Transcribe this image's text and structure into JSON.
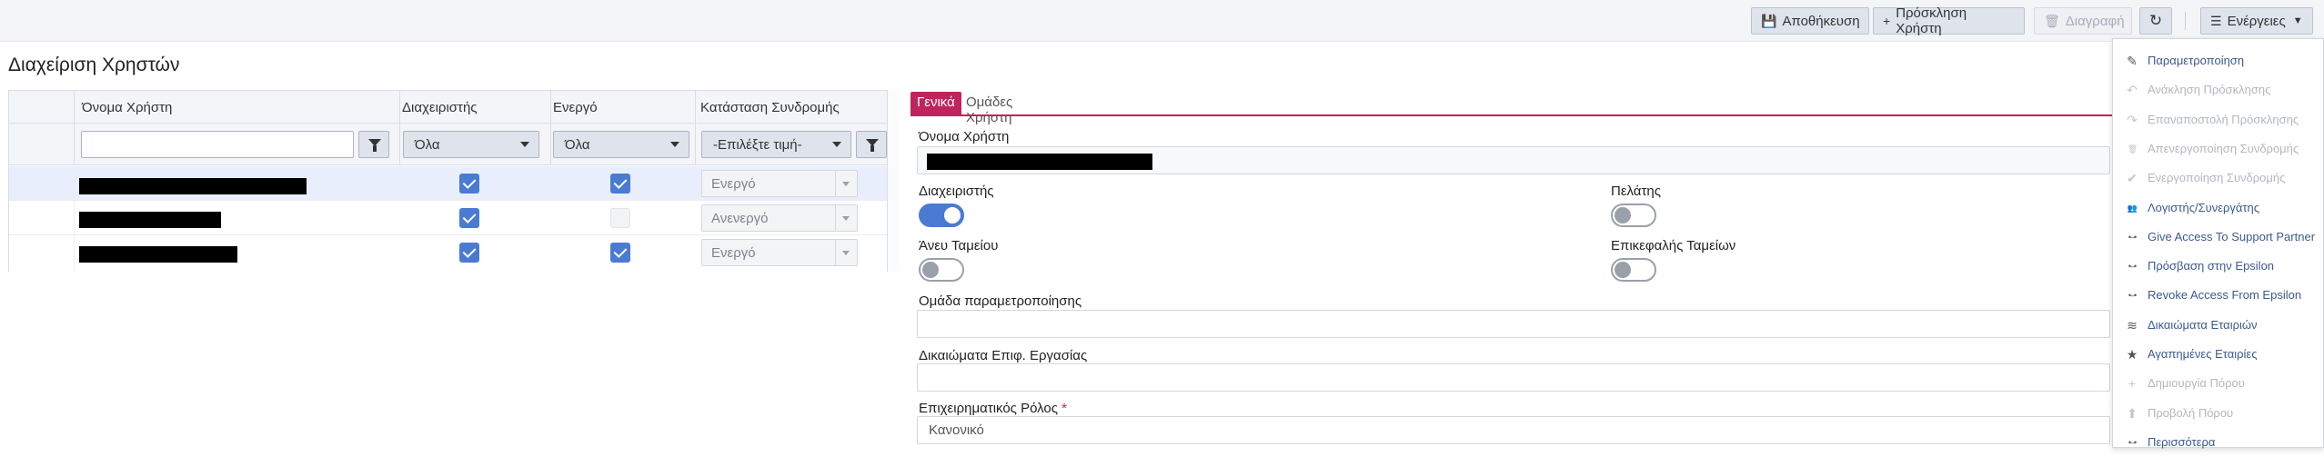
{
  "toolbar": {
    "save_label": "Αποθήκευση",
    "invite_label": "Πρόσκληση Χρήστη",
    "delete_label": "Διαγραφή",
    "actions_label": "Ενέργειες"
  },
  "page": {
    "title": "Διαχείριση Χρηστών"
  },
  "grid": {
    "columns": [
      "Όνομα Χρήστη",
      "Διαχειριστής",
      "Ενεργό",
      "Κατάσταση Συνδρομής"
    ],
    "filters": {
      "username_value": "",
      "admin_value": "Όλα",
      "active_value": "Όλα",
      "subscription_value": "-Επιλέξτε τιμή-"
    },
    "rows": [
      {
        "username": "[redacted]",
        "admin": true,
        "active": true,
        "subscription": "Ενεργό",
        "selected": true
      },
      {
        "username": "[redacted]",
        "admin": true,
        "active": false,
        "subscription": "Ανενεργό",
        "selected": false
      },
      {
        "username": "[redacted]",
        "admin": true,
        "active": true,
        "subscription": "Ενεργό",
        "selected": false
      }
    ]
  },
  "details": {
    "tabs": [
      "Γενικά",
      "Ομάδες Χρήστη"
    ],
    "active_tab": "Γενικά",
    "username_label": "Όνομα Χρήστη",
    "username_value": "[redacted]",
    "admin_label": "Διαχειριστής",
    "admin_on": true,
    "customer_label": "Πελάτης",
    "customer_on": false,
    "no_register_label": "Άνευ Ταμείου",
    "no_register_on": false,
    "register_head_label": "Επικεφαλής Ταμείων",
    "register_head_on": false,
    "param_group_label": "Ομάδα παραμετροποίησης",
    "param_group_value": "",
    "work_rights_label": "Δικαιώματα Επιφ. Εργασίας",
    "work_rights_value": "",
    "business_role_label": "Επιχειρηματικός Ρόλος",
    "business_role_required": "*",
    "business_role_value": "Κανονικό"
  },
  "actions_menu": {
    "items": [
      {
        "label": "Παραμετροποίηση",
        "icon": "edit-icon",
        "glyph": "✎",
        "enabled": true
      },
      {
        "label": "Ανάκληση Πρόσκλησης",
        "icon": "undo-icon",
        "glyph": "↶",
        "enabled": false
      },
      {
        "label": "Επαναποστολή Πρόσκλησης",
        "icon": "share-icon",
        "glyph": "↷",
        "enabled": false
      },
      {
        "label": "Απενεργοποίηση Συνδρομής",
        "icon": "trash-icon",
        "glyph": "🗑",
        "enabled": false
      },
      {
        "label": "Ενεργοποίηση Συνδρομής",
        "icon": "check-circle-icon",
        "glyph": "✔",
        "enabled": false
      },
      {
        "label": "Λογιστής/Συνεργάτης",
        "icon": "users-icon",
        "glyph": "👥",
        "enabled": true
      },
      {
        "label": "Give Access To Support Partner",
        "icon": "dots-icon",
        "glyph": "•–•",
        "enabled": true
      },
      {
        "label": "Πρόσβαση στην Epsilon",
        "icon": "dots-icon",
        "glyph": "•–•",
        "enabled": true
      },
      {
        "label": "Revoke Access From Epsilon",
        "icon": "dots-icon",
        "glyph": "•–•",
        "enabled": true
      },
      {
        "label": "Δικαιώματα Εταιριών",
        "icon": "layers-icon",
        "glyph": "≋",
        "enabled": true
      },
      {
        "label": "Αγαπημένες Εταιρίες",
        "icon": "star-icon",
        "glyph": "★",
        "enabled": true
      },
      {
        "label": "Δημιουργία Πόρου",
        "icon": "plus-icon",
        "glyph": "+",
        "enabled": false
      },
      {
        "label": "Προβολή Πόρου",
        "icon": "arrow-up-icon",
        "glyph": "⬆",
        "enabled": false
      },
      {
        "label": "Περισσότερα",
        "icon": "dots-icon",
        "glyph": "•–•",
        "enabled": true
      }
    ]
  },
  "colors": {
    "accent": "#c0245c",
    "checkbox_blue": "#4a7bd3",
    "link_blue": "#3c5a8f"
  }
}
